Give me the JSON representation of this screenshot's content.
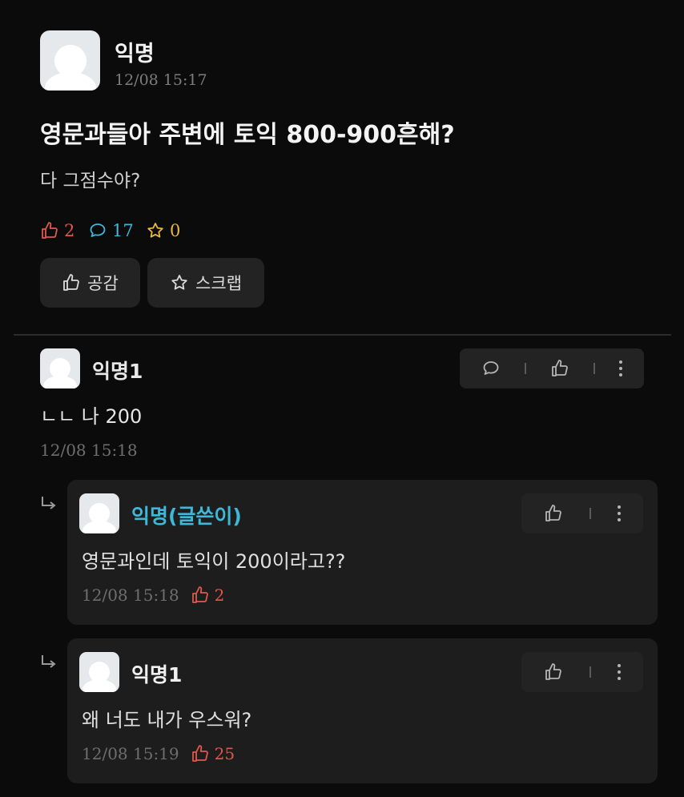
{
  "post": {
    "author": "익명",
    "time": "12/08 15:17",
    "title": "영문과들아 주변에 토익 800-900흔해?",
    "body": "다 그점수야?",
    "stats": {
      "likes": "2",
      "comments": "17",
      "scraps": "0"
    },
    "actions": {
      "sympathy_label": "공감",
      "scrap_label": "스크랩"
    }
  },
  "comments": [
    {
      "author": "익명1",
      "text": "ㄴㄴ 나 200",
      "time": "12/08 15:18",
      "replies": [
        {
          "author": "익명(글쓴이)",
          "text": "영문과인데 토익이 200이라고??",
          "time": "12/08 15:18",
          "likes": "2",
          "author_color": "#3fb8d8"
        },
        {
          "author": "익명1",
          "text": "왜 너도 내가 우스워?",
          "time": "12/08 15:19",
          "likes": "25",
          "author_color": "#f0f0f0"
        }
      ]
    }
  ],
  "colors": {
    "like": "#e2574c",
    "comment": "#3fb8d8",
    "scrap": "#e8b93a",
    "background": "#0b0b0b",
    "card": "#1d1d1d"
  }
}
